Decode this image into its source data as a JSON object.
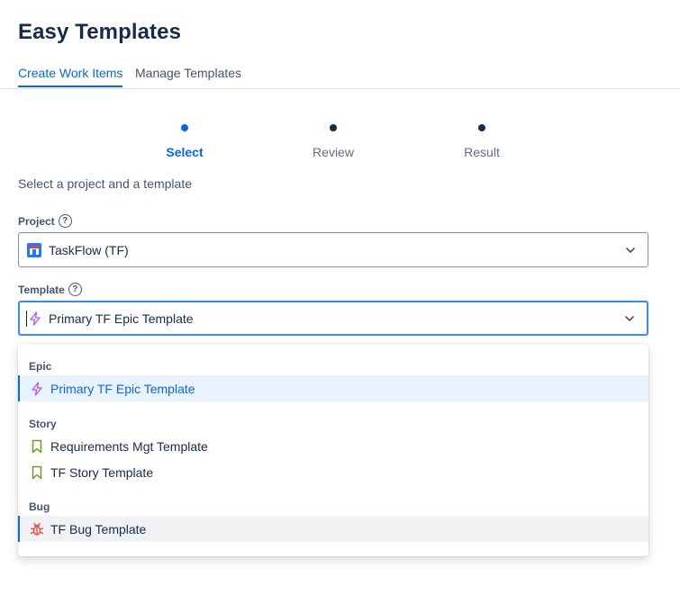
{
  "app": {
    "title": "Easy Templates"
  },
  "tabs": [
    {
      "label": "Create Work Items",
      "active": true
    },
    {
      "label": "Manage Templates",
      "active": false
    }
  ],
  "steps": [
    {
      "label": "Select",
      "state": "current"
    },
    {
      "label": "Review",
      "state": "upcoming"
    },
    {
      "label": "Result",
      "state": "upcoming"
    }
  ],
  "form": {
    "subtitle": "Select a project and a template",
    "project": {
      "label": "Project",
      "value": "TaskFlow (TF)",
      "icon": "project-avatar-icon"
    },
    "template": {
      "label": "Template",
      "value": "Primary TF Epic Template",
      "icon": "epic-lightning-icon"
    }
  },
  "dropdown": {
    "groups": [
      {
        "name": "Epic",
        "items": [
          {
            "label": "Primary TF Epic Template",
            "icon": "epic-lightning-icon",
            "selected": true
          }
        ]
      },
      {
        "name": "Story",
        "items": [
          {
            "label": "Requirements Mgt Template",
            "icon": "story-bookmark-icon"
          },
          {
            "label": "TF Story Template",
            "icon": "story-bookmark-icon"
          }
        ]
      },
      {
        "name": "Bug",
        "items": [
          {
            "label": "TF Bug Template",
            "icon": "bug-icon",
            "hovered": true
          }
        ]
      }
    ]
  },
  "colors": {
    "accent": "#0c66e4",
    "epic": "#af59e1",
    "story": "#6a9a23",
    "bug": "#e2483d",
    "selected_bg": "#e9f2ff",
    "hover_bg": "#f1f2f4"
  }
}
